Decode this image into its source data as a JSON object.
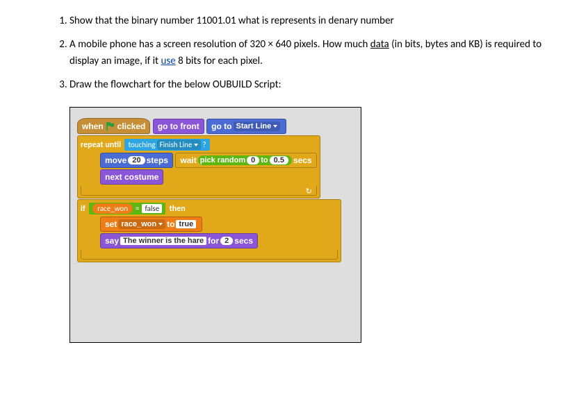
{
  "questions": {
    "q1": "Show that the binary number 11001.01 what is represents in denary number",
    "q2_a": "A mobile phone has a screen resolution of 320 × 640 pixels. How much ",
    "q2_data": "data",
    "q2_b": " (in bits, bytes and KB) is required to display an image, if it ",
    "q2_use": "use",
    "q2_c": " 8 bits for each pixel.",
    "q3": "Draw the flowchart for the below OUBUILD Script:"
  },
  "script": {
    "when": "when",
    "clicked": "clicked",
    "go_to_front": "go to front",
    "go_to": "go to",
    "start_line": "Start Line",
    "repeat_until": "repeat until",
    "touching": "touching",
    "finish_line": "Finish Line",
    "question": "?",
    "move": "move",
    "move_steps": "20",
    "steps": "steps",
    "wait": "wait",
    "pick_random": "pick random",
    "rand_from": "0",
    "rand_to_label": "to",
    "rand_to": "0.5",
    "secs": "secs",
    "next_costume": "next costume",
    "if": "if",
    "race_won": "race_won",
    "equals": "=",
    "false": "false",
    "then": "then",
    "set": "set",
    "to": "to",
    "true": "true",
    "say": "say",
    "say_text": "The winner is the hare",
    "for": "for",
    "say_secs": "2"
  }
}
